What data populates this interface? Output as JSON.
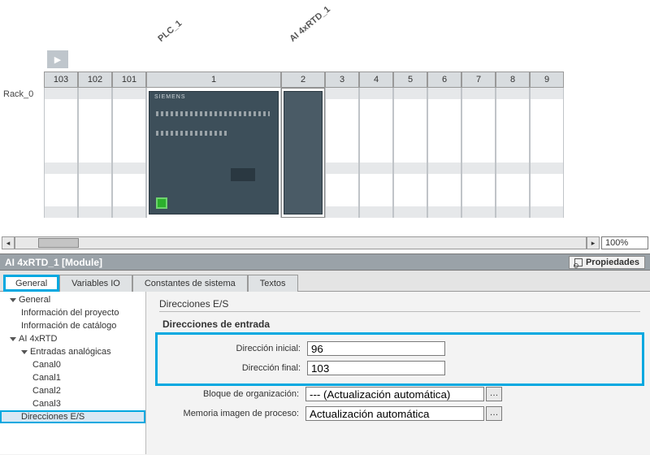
{
  "rack": {
    "name": "Rack_0",
    "label_plc": "PLC_1",
    "label_rtd": "AI 4xRTD_1",
    "slots": [
      "103",
      "102",
      "101",
      "1",
      "2",
      "3",
      "4",
      "5",
      "6",
      "7",
      "8",
      "9"
    ],
    "plc_brand": "SIEMENS"
  },
  "zoom": "100%",
  "inspector": {
    "title": "AI 4xRTD_1 [Module]",
    "properties_btn": "Propiedades",
    "tabs": {
      "general": "General",
      "vars": "Variables IO",
      "consts": "Constantes de sistema",
      "texts": "Textos"
    },
    "nav": {
      "general": "General",
      "info_proj": "Información del proyecto",
      "info_cat": "Información de catálogo",
      "ai4xrtd": "AI 4xRTD",
      "analog_in": "Entradas analógicas",
      "ch0": "Canal0",
      "ch1": "Canal1",
      "ch2": "Canal2",
      "ch3": "Canal3",
      "dir_es": "Direcciones E/S"
    },
    "form": {
      "section": "Direcciones E/S",
      "subsection": "Direcciones de entrada",
      "addr_start_lbl": "Dirección inicial:",
      "addr_start_val": "96",
      "addr_end_lbl": "Dirección final:",
      "addr_end_val": "103",
      "ob_lbl": "Bloque de organización:",
      "ob_val": "--- (Actualización automática)",
      "pimg_lbl": "Memoria imagen de proceso:",
      "pimg_val": "Actualización automática"
    }
  }
}
